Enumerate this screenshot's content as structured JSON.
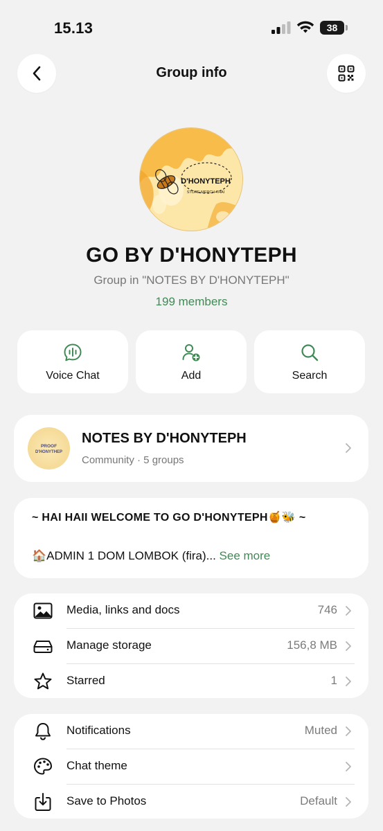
{
  "status_bar": {
    "time": "15.13",
    "battery": "38"
  },
  "header": {
    "title": "Group info",
    "back_icon": "chevron-left-icon",
    "qr_icon": "qr-code-icon"
  },
  "group": {
    "avatar_text": "D'HONYTEPH",
    "avatar_subtext": "STORE MERCH THAI",
    "name": "GO BY D'HONYTEPH",
    "subtitle": "Group in \"NOTES BY D'HONYTEPH\"",
    "members": "199 members"
  },
  "actions": [
    {
      "label": "Voice Chat",
      "icon": "voice-chat-icon"
    },
    {
      "label": "Add",
      "icon": "add-person-icon"
    },
    {
      "label": "Search",
      "icon": "search-icon"
    }
  ],
  "community": {
    "avatar_text_1": "PROOF",
    "avatar_text_2": "D'HONYTHEP",
    "title": "NOTES BY D'HONYTEPH",
    "subtitle": "Community · 5 groups"
  },
  "description": {
    "line1": "~ HAI HAII WELCOME TO GO D'HONYTEPH🍯🐝 ~",
    "line2": "🏠ADMIN 1 DOM LOMBOK (fira)...",
    "see_more": "See more"
  },
  "list1": [
    {
      "label": "Media, links and docs",
      "value": "746",
      "icon": "photo-icon"
    },
    {
      "label": "Manage storage",
      "value": "156,8 MB",
      "icon": "storage-icon"
    },
    {
      "label": "Starred",
      "value": "1",
      "icon": "star-icon"
    }
  ],
  "list2": [
    {
      "label": "Notifications",
      "value": "Muted",
      "icon": "bell-icon"
    },
    {
      "label": "Chat theme",
      "value": "",
      "icon": "palette-icon"
    },
    {
      "label": "Save to Photos",
      "value": "Default",
      "icon": "save-download-icon"
    }
  ],
  "colors": {
    "accent": "#3f8a55",
    "background": "#f2f2f2",
    "card": "#ffffff"
  }
}
